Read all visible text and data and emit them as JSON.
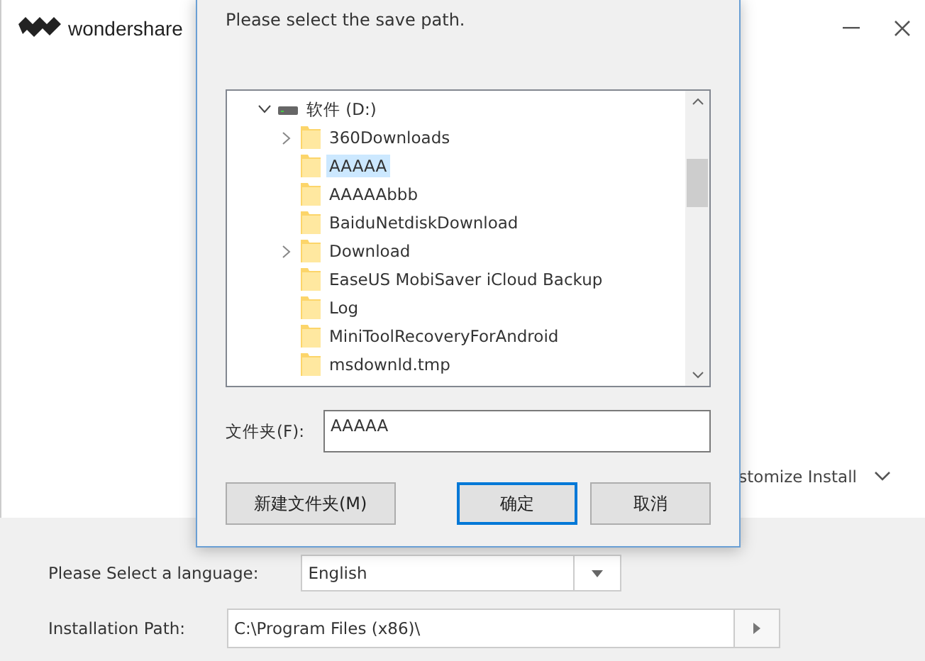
{
  "installer": {
    "brand": "wondershare",
    "customize": {
      "label": "stomize Install",
      "expanded": false
    },
    "language": {
      "label": "Please Select a language:",
      "value": "English"
    },
    "path": {
      "label": "Installation Path:",
      "value": "C:\\Program Files (x86)\\"
    }
  },
  "dialog": {
    "prompt": "Please select the save path.",
    "tree": [
      {
        "label": "软件 (D:)",
        "kind": "drive",
        "expanded": true,
        "selected": false,
        "children": [
          {
            "label": "360Downloads",
            "kind": "folder",
            "expanded": false,
            "selected": false
          },
          {
            "label": "AAAAA",
            "kind": "folder",
            "selected": true
          },
          {
            "label": "AAAAAbbb",
            "kind": "folder",
            "selected": false
          },
          {
            "label": "BaiduNetdiskDownload",
            "kind": "folder",
            "selected": false
          },
          {
            "label": "Download",
            "kind": "folder",
            "expanded": false,
            "selected": false
          },
          {
            "label": "EaseUS MobiSaver iCloud Backup",
            "kind": "folder",
            "selected": false
          },
          {
            "label": "Log",
            "kind": "folder",
            "selected": false
          },
          {
            "label": "MiniToolRecoveryForAndroid",
            "kind": "folder",
            "selected": false
          },
          {
            "label": "msdownld.tmp",
            "kind": "folder",
            "selected": false
          }
        ]
      }
    ],
    "folder": {
      "label": "文件夹(F):",
      "value": "AAAAA"
    },
    "buttons": [
      {
        "label": "新建文件夹(M)",
        "default": false
      },
      {
        "label": "确定",
        "default": true
      },
      {
        "label": "取消",
        "default": false
      }
    ]
  }
}
